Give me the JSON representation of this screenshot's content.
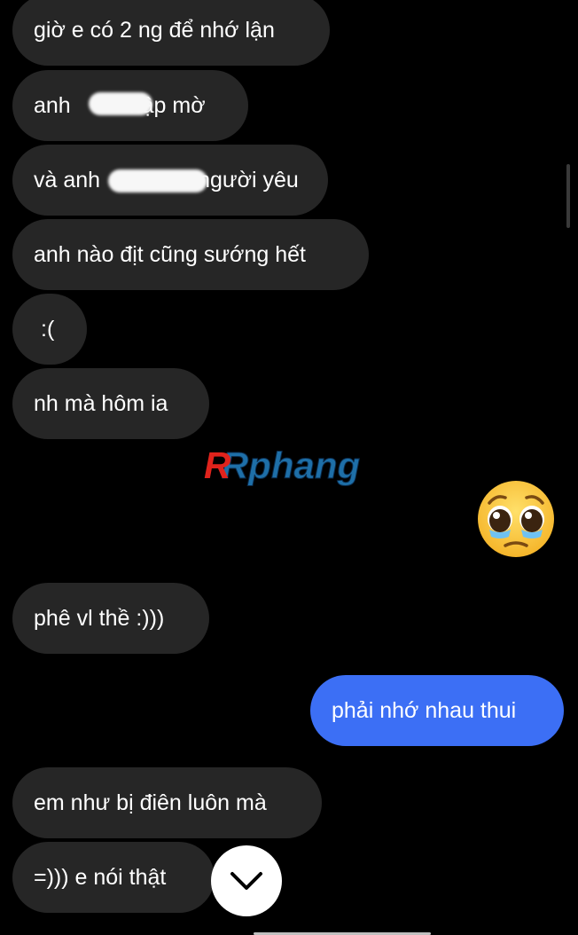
{
  "messages": [
    {
      "side": "in",
      "text": "giờ e có 2 ng để nhớ lận"
    },
    {
      "side": "in",
      "parts": [
        "anh",
        "nập mờ"
      ],
      "redacted": true
    },
    {
      "side": "in",
      "parts": [
        "và anh",
        "người yêu"
      ],
      "redacted": true
    },
    {
      "side": "in",
      "text": "anh nào địt cũng sướng hết"
    },
    {
      "side": "in",
      "text": ":("
    },
    {
      "side": "in",
      "text": "nh mà hôm ia"
    },
    {
      "side": "out",
      "emoji": "pleading-face-emoji"
    },
    {
      "side": "in",
      "text": "phê vl thề :)))"
    },
    {
      "side": "out",
      "text": "phải nhớ nhau thui"
    },
    {
      "side": "in",
      "text": "em như bị điên luôn mà"
    },
    {
      "side": "in",
      "text": "=))) e nói thật"
    }
  ],
  "watermark": {
    "text": "Rphang"
  },
  "controls": {
    "scroll_down_icon": "chevron-down-icon"
  },
  "colors": {
    "background": "#000000",
    "incoming_bubble": "#262626",
    "outgoing_bubble": "#3c6ff5"
  }
}
